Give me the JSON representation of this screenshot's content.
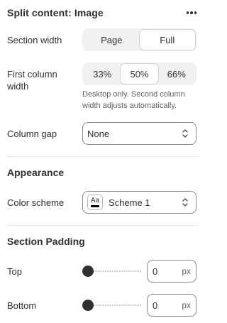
{
  "header": {
    "title": "Split content: Image",
    "more_icon": "more-horizontal-icon"
  },
  "section_width": {
    "label": "Section width",
    "options": [
      "Page",
      "Full"
    ],
    "selected": "Full"
  },
  "first_column_width": {
    "label": "First column width",
    "options": [
      "33%",
      "50%",
      "66%"
    ],
    "selected": "50%",
    "help": "Desktop only. Second column width adjusts automatically."
  },
  "column_gap": {
    "label": "Column gap",
    "value": "None",
    "icon": "chevron-up-down-icon"
  },
  "appearance": {
    "heading": "Appearance",
    "color_scheme": {
      "label": "Color scheme",
      "swatch_text": "Aa",
      "value": "Scheme 1",
      "swatch_accent": "#000000"
    }
  },
  "section_padding": {
    "heading": "Section Padding",
    "top": {
      "label": "Top",
      "value": "0",
      "unit": "px",
      "level": 0
    },
    "bottom": {
      "label": "Bottom",
      "value": "0",
      "unit": "px",
      "level": 0
    }
  },
  "colors": {
    "text": "#303030",
    "muted": "#616161",
    "segment_bg": "#f1f1f1",
    "border": "#8a8a8a",
    "thumb": "#303030"
  }
}
